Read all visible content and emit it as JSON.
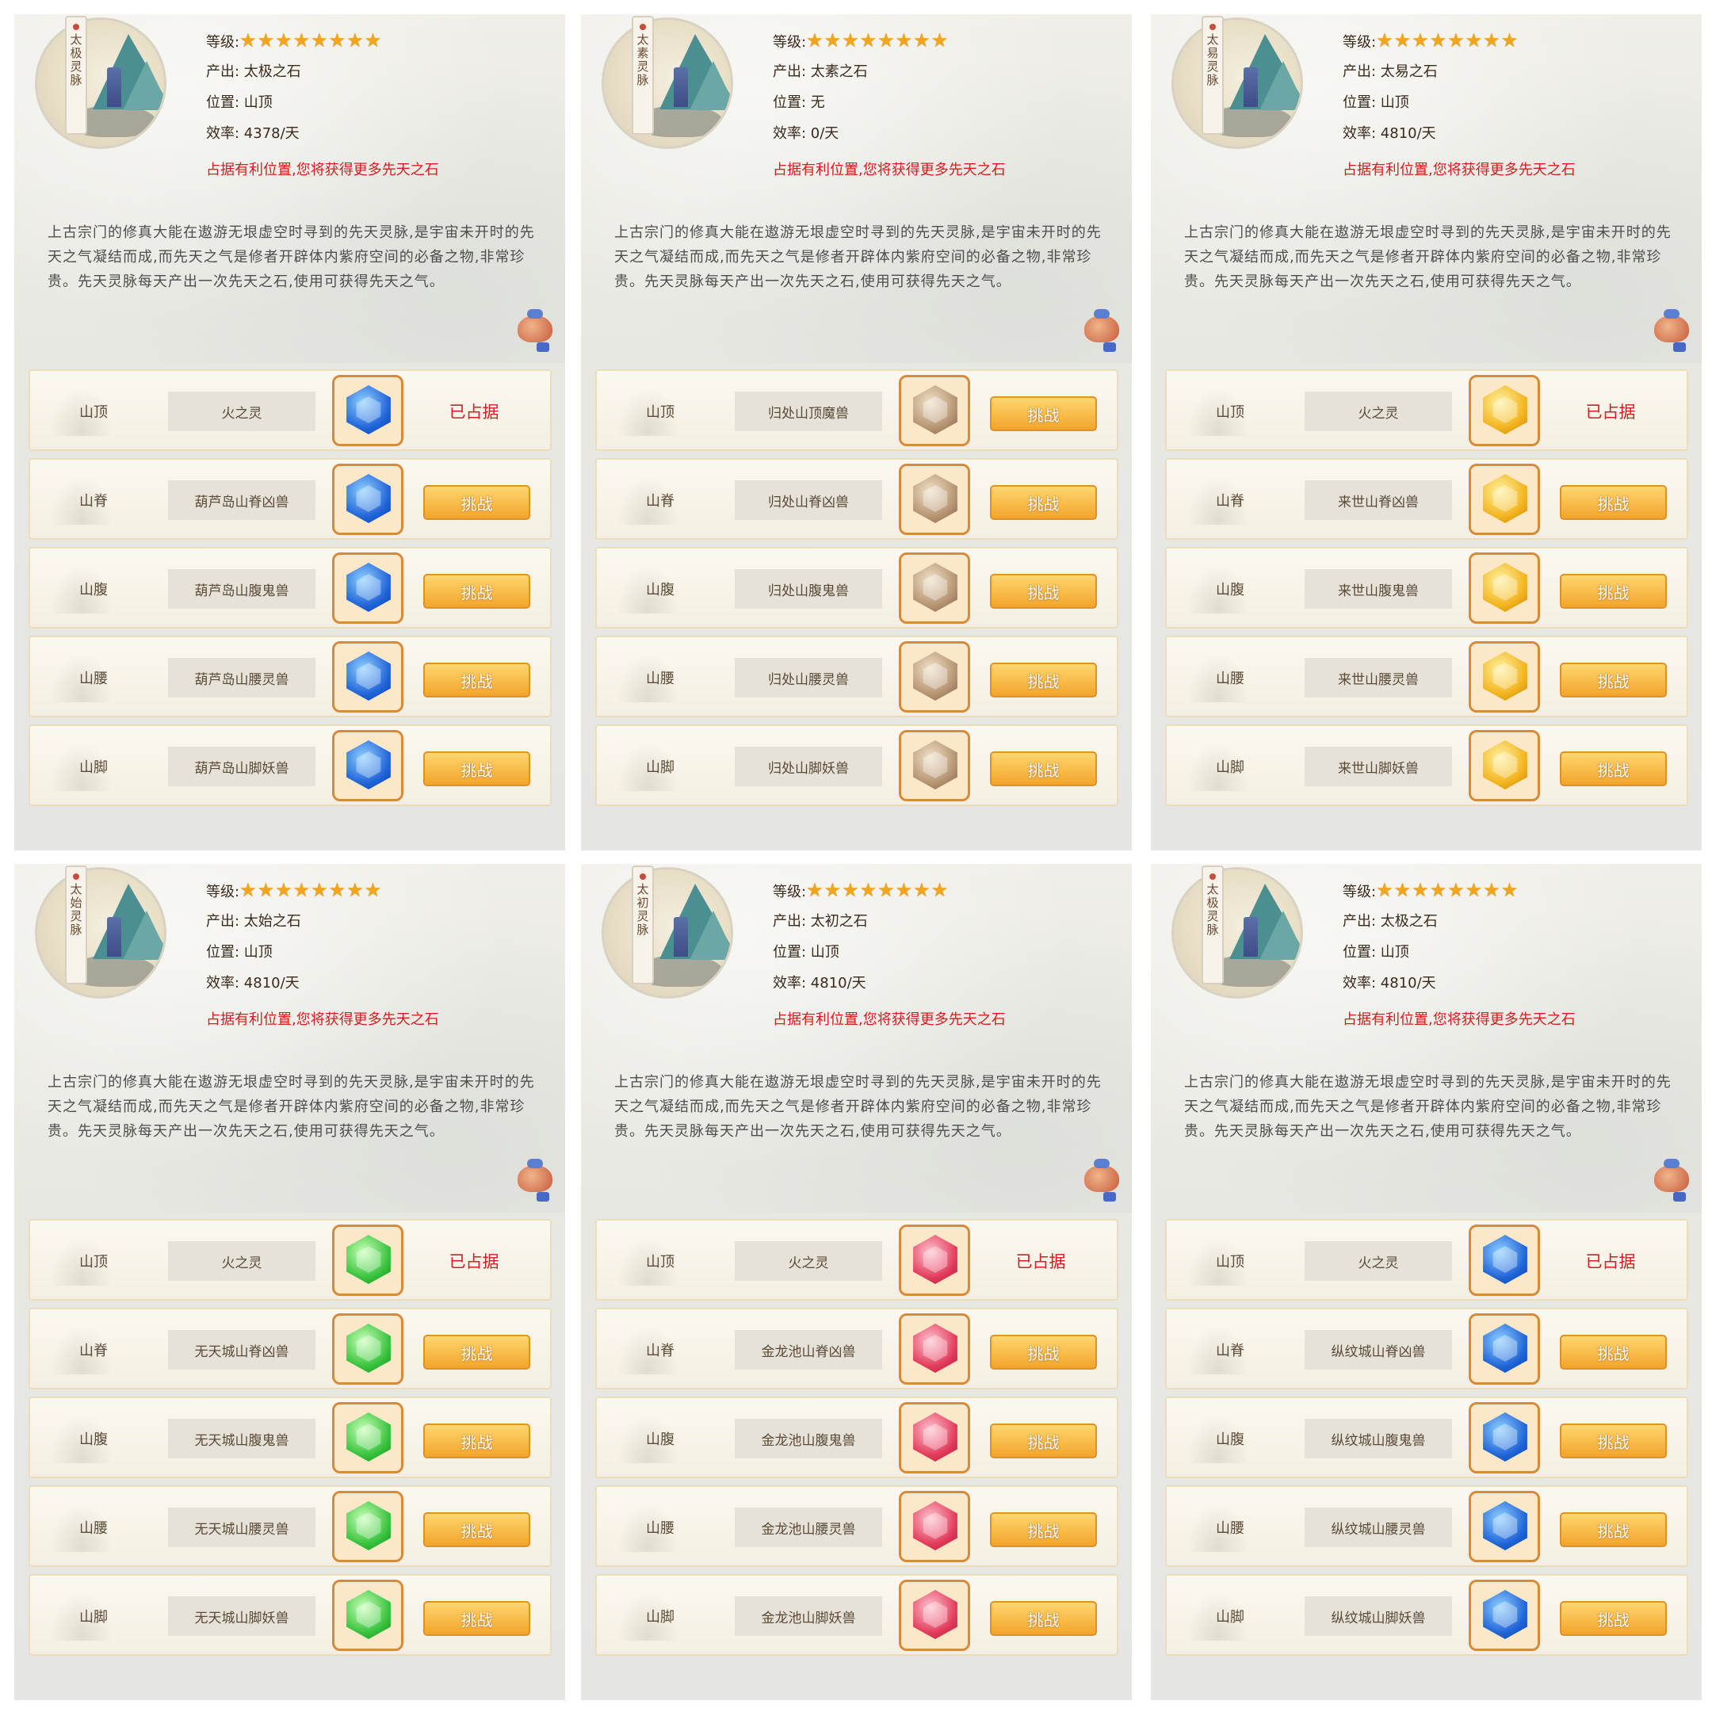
{
  "colors": {
    "warning": "#d21e1e",
    "star": "#f0a51c",
    "button": "#f3a42b"
  },
  "panels": [
    {
      "scroll_title": "太极灵脉",
      "level_label": "等级:",
      "stars": "★★★★★★★★",
      "output": "产出: 太极之石",
      "position": "位置: 山顶",
      "efficiency": "效率: 4378/天",
      "warning": "占据有利位置,您将获得更多先天之石",
      "description": "上古宗门的修真大能在遨游无垠虚空时寻到的先天灵脉,是宇宙未开时的先天之气凝结而成,而先天之气是修者开辟体内紫府空间的必备之物,非常珍贵。先天灵脉每天产出一次先天之石,使用可获得先天之气。",
      "gem_color": "blue",
      "rows": [
        {
          "loc": "山顶",
          "name": "火之灵",
          "action": "已占据",
          "occupied": true
        },
        {
          "loc": "山脊",
          "name": "葫芦岛山脊凶兽",
          "action": "挑战",
          "occupied": false
        },
        {
          "loc": "山腹",
          "name": "葫芦岛山腹鬼兽",
          "action": "挑战",
          "occupied": false
        },
        {
          "loc": "山腰",
          "name": "葫芦岛山腰灵兽",
          "action": "挑战",
          "occupied": false
        },
        {
          "loc": "山脚",
          "name": "葫芦岛山脚妖兽",
          "action": "挑战",
          "occupied": false
        }
      ]
    },
    {
      "scroll_title": "太素灵脉",
      "level_label": "等级:",
      "stars": "★★★★★★★★",
      "output": "产出: 太素之石",
      "position": "位置: 无",
      "efficiency": "效率: 0/天",
      "warning": "占据有利位置,您将获得更多先天之石",
      "description": "上古宗门的修真大能在遨游无垠虚空时寻到的先天灵脉,是宇宙未开时的先天之气凝结而成,而先天之气是修者开辟体内紫府空间的必备之物,非常珍贵。先天灵脉每天产出一次先天之石,使用可获得先天之气。",
      "gem_color": "bronze",
      "rows": [
        {
          "loc": "山顶",
          "name": "归处山顶魔兽",
          "action": "挑战",
          "occupied": false
        },
        {
          "loc": "山脊",
          "name": "归处山脊凶兽",
          "action": "挑战",
          "occupied": false
        },
        {
          "loc": "山腹",
          "name": "归处山腹鬼兽",
          "action": "挑战",
          "occupied": false
        },
        {
          "loc": "山腰",
          "name": "归处山腰灵兽",
          "action": "挑战",
          "occupied": false
        },
        {
          "loc": "山脚",
          "name": "归处山脚妖兽",
          "action": "挑战",
          "occupied": false
        }
      ]
    },
    {
      "scroll_title": "太易灵脉",
      "level_label": "等级:",
      "stars": "★★★★★★★★",
      "output": "产出: 太易之石",
      "position": "位置: 山顶",
      "efficiency": "效率: 4810/天",
      "warning": "占据有利位置,您将获得更多先天之石",
      "description": "上古宗门的修真大能在遨游无垠虚空时寻到的先天灵脉,是宇宙未开时的先天之气凝结而成,而先天之气是修者开辟体内紫府空间的必备之物,非常珍贵。先天灵脉每天产出一次先天之石,使用可获得先天之气。",
      "gem_color": "gold",
      "rows": [
        {
          "loc": "山顶",
          "name": "火之灵",
          "action": "已占据",
          "occupied": true
        },
        {
          "loc": "山脊",
          "name": "来世山脊凶兽",
          "action": "挑战",
          "occupied": false
        },
        {
          "loc": "山腹",
          "name": "来世山腹鬼兽",
          "action": "挑战",
          "occupied": false
        },
        {
          "loc": "山腰",
          "name": "来世山腰灵兽",
          "action": "挑战",
          "occupied": false
        },
        {
          "loc": "山脚",
          "name": "来世山脚妖兽",
          "action": "挑战",
          "occupied": false
        }
      ]
    },
    {
      "scroll_title": "太始灵脉",
      "level_label": "等级:",
      "stars": "★★★★★★★★",
      "output": "产出: 太始之石",
      "position": "位置: 山顶",
      "efficiency": "效率: 4810/天",
      "warning": "占据有利位置,您将获得更多先天之石",
      "description": "上古宗门的修真大能在遨游无垠虚空时寻到的先天灵脉,是宇宙未开时的先天之气凝结而成,而先天之气是修者开辟体内紫府空间的必备之物,非常珍贵。先天灵脉每天产出一次先天之石,使用可获得先天之气。",
      "gem_color": "green",
      "rows": [
        {
          "loc": "山顶",
          "name": "火之灵",
          "action": "已占据",
          "occupied": true
        },
        {
          "loc": "山脊",
          "name": "无天城山脊凶兽",
          "action": "挑战",
          "occupied": false
        },
        {
          "loc": "山腹",
          "name": "无天城山腹鬼兽",
          "action": "挑战",
          "occupied": false
        },
        {
          "loc": "山腰",
          "name": "无天城山腰灵兽",
          "action": "挑战",
          "occupied": false
        },
        {
          "loc": "山脚",
          "name": "无天城山脚妖兽",
          "action": "挑战",
          "occupied": false
        }
      ]
    },
    {
      "scroll_title": "太初灵脉",
      "level_label": "等级:",
      "stars": "★★★★★★★★",
      "output": "产出: 太初之石",
      "position": "位置: 山顶",
      "efficiency": "效率: 4810/天",
      "warning": "占据有利位置,您将获得更多先天之石",
      "description": "上古宗门的修真大能在遨游无垠虚空时寻到的先天灵脉,是宇宙未开时的先天之气凝结而成,而先天之气是修者开辟体内紫府空间的必备之物,非常珍贵。先天灵脉每天产出一次先天之石,使用可获得先天之气。",
      "gem_color": "red",
      "rows": [
        {
          "loc": "山顶",
          "name": "火之灵",
          "action": "已占据",
          "occupied": true
        },
        {
          "loc": "山脊",
          "name": "金龙池山脊凶兽",
          "action": "挑战",
          "occupied": false
        },
        {
          "loc": "山腹",
          "name": "金龙池山腹鬼兽",
          "action": "挑战",
          "occupied": false
        },
        {
          "loc": "山腰",
          "name": "金龙池山腰灵兽",
          "action": "挑战",
          "occupied": false
        },
        {
          "loc": "山脚",
          "name": "金龙池山脚妖兽",
          "action": "挑战",
          "occupied": false
        }
      ]
    },
    {
      "scroll_title": "太极灵脉",
      "level_label": "等级:",
      "stars": "★★★★★★★★",
      "output": "产出: 太极之石",
      "position": "位置: 山顶",
      "efficiency": "效率: 4810/天",
      "warning": "占据有利位置,您将获得更多先天之石",
      "description": "上古宗门的修真大能在遨游无垠虚空时寻到的先天灵脉,是宇宙未开时的先天之气凝结而成,而先天之气是修者开辟体内紫府空间的必备之物,非常珍贵。先天灵脉每天产出一次先天之石,使用可获得先天之气。",
      "gem_color": "blue",
      "rows": [
        {
          "loc": "山顶",
          "name": "火之灵",
          "action": "已占据",
          "occupied": true
        },
        {
          "loc": "山脊",
          "name": "纵纹城山脊凶兽",
          "action": "挑战",
          "occupied": false
        },
        {
          "loc": "山腹",
          "name": "纵纹城山腹鬼兽",
          "action": "挑战",
          "occupied": false
        },
        {
          "loc": "山腰",
          "name": "纵纹城山腰灵兽",
          "action": "挑战",
          "occupied": false
        },
        {
          "loc": "山脚",
          "name": "纵纹城山脚妖兽",
          "action": "挑战",
          "occupied": false
        }
      ]
    }
  ]
}
